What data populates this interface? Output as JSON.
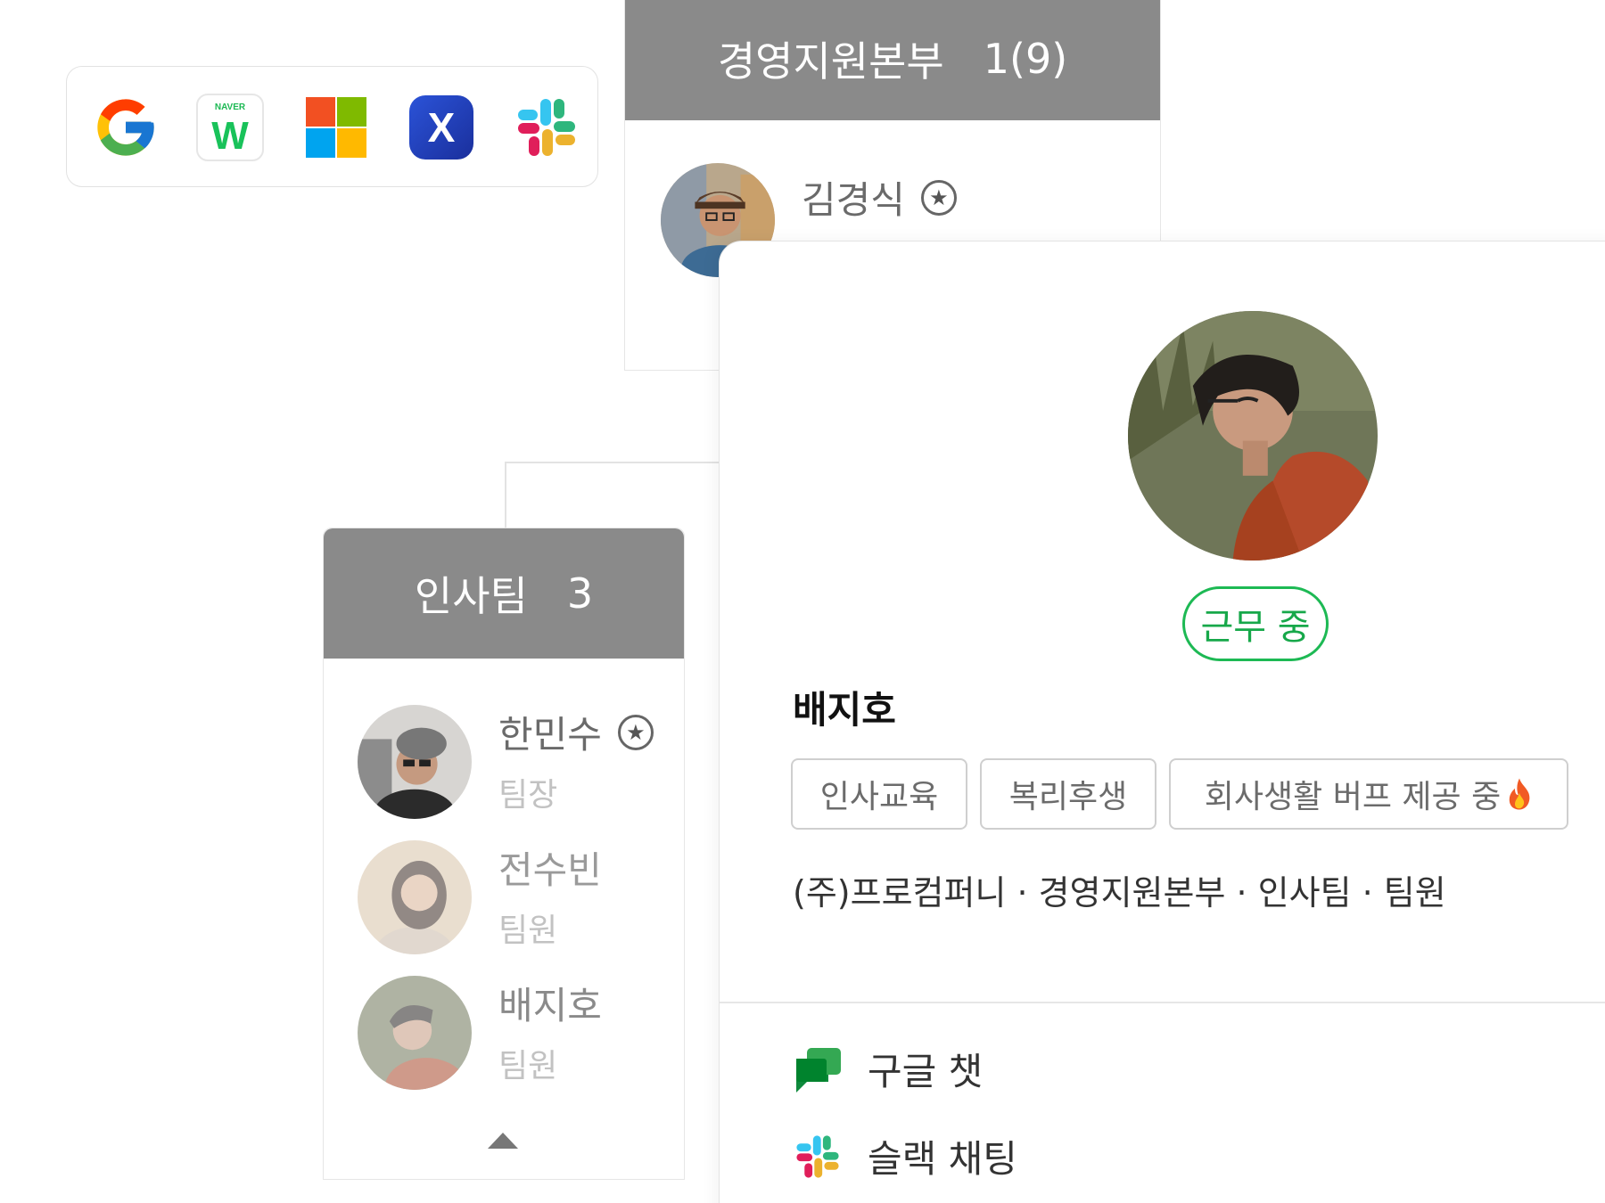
{
  "integrations": [
    {
      "name": "google-icon"
    },
    {
      "name": "naver-works-icon",
      "badge": "NAVER",
      "letter": "W"
    },
    {
      "name": "microsoft-icon"
    },
    {
      "name": "x-app-icon",
      "letter": "X"
    },
    {
      "name": "slack-icon"
    }
  ],
  "departments": {
    "division": {
      "name": "경영지원본부",
      "count": "1(9)",
      "members": [
        {
          "name": "김경식",
          "leader": true
        }
      ]
    },
    "team": {
      "name": "인사팀",
      "count": "3",
      "members": [
        {
          "name": "한민수",
          "role": "팀장",
          "leader": true
        },
        {
          "name": "전수빈",
          "role": "팀원",
          "leader": false
        },
        {
          "name": "배지호",
          "role": "팀원",
          "leader": false
        }
      ],
      "collapse_icon": "caret-up-icon"
    }
  },
  "profile": {
    "status": "근무 중",
    "name": "배지호",
    "tags": [
      "인사교육",
      "복리후생",
      "회사생활 버프 제공 중"
    ],
    "tag_emoji": "fire-icon",
    "org_path": "(주)프로컴퍼니 · 경영지원본부 · 인사팀 · 팀원",
    "actions": [
      {
        "label": "구글 챗",
        "icon": "google-chat-icon"
      },
      {
        "label": "슬랙 채팅",
        "icon": "slack-icon"
      }
    ]
  },
  "colors": {
    "accent": "#1db954",
    "header_gray": "#8a8a8a"
  }
}
